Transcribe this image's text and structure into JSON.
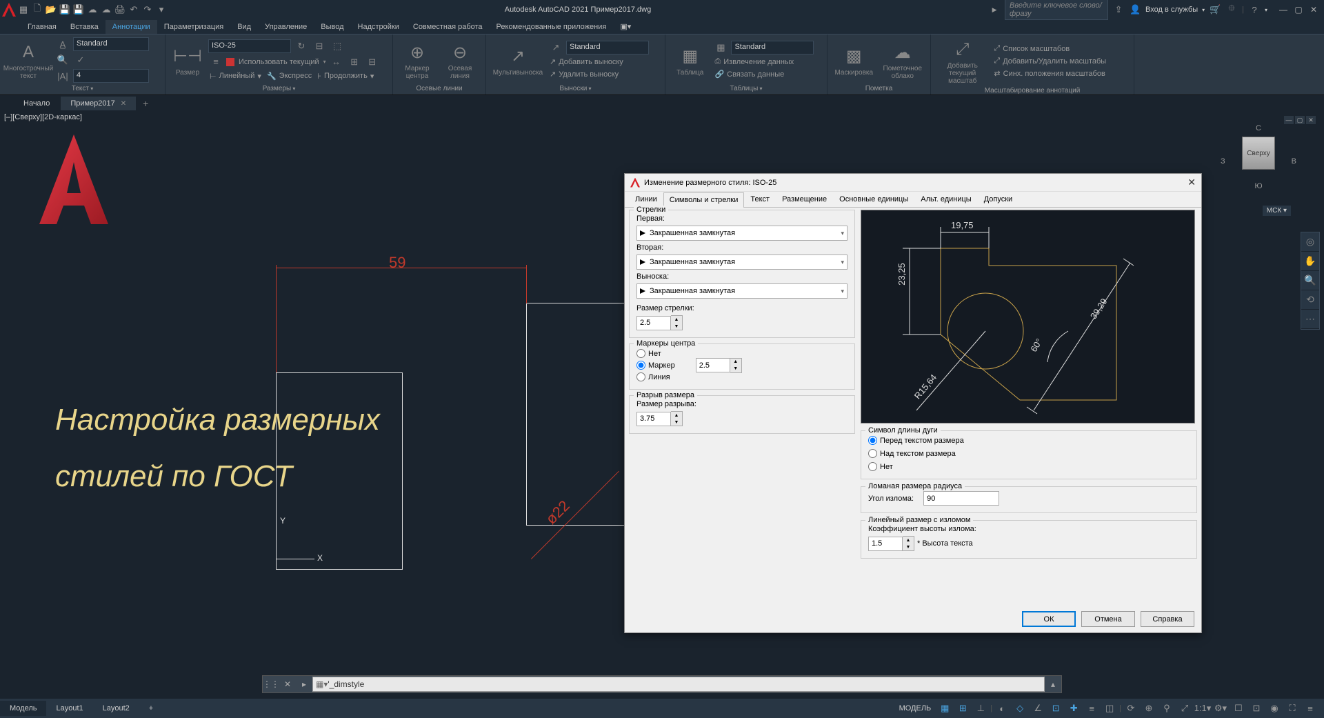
{
  "app": {
    "title": "Autodesk AutoCAD 2021   Пример2017.dwg"
  },
  "titlebar": {
    "search_placeholder": "Введите ключевое слово/фразу",
    "signin": "Вход в службы"
  },
  "ribbon_tabs": [
    "Главная",
    "Вставка",
    "Аннотации",
    "Параметризация",
    "Вид",
    "Управление",
    "Вывод",
    "Надстройки",
    "Совместная работа",
    "Рекомендованные приложения"
  ],
  "ribbon_active_tab": "Аннотации",
  "ribbon": {
    "text_panel": {
      "big": "Многострочный текст",
      "style": "Standard",
      "height": "4",
      "title": "Текст"
    },
    "dim_panel": {
      "big": "Размер",
      "style": "ISO-25",
      "use_current": "Использовать текущий",
      "linear": "Линейный",
      "express": "Экспресс",
      "continue": "Продолжить",
      "title": "Размеры"
    },
    "center_panel": {
      "marker": "Маркер центра",
      "axis": "Осевая линия",
      "title": "Осевые линии"
    },
    "leader_panel": {
      "multi": "Мультивыноска",
      "style": "Standard",
      "add": "Добавить выноску",
      "del": "Удалить выноску",
      "title": "Выноски"
    },
    "table_panel": {
      "big": "Таблица",
      "style": "Standard",
      "extract": "Извлечение данных",
      "link": "Связать данные",
      "title": "Таблицы"
    },
    "mark_panel": {
      "mask": "Маскировка",
      "cloud": "Пометочное облако",
      "title": "Пометка"
    },
    "scale_panel": {
      "add_del": "Добавить текущий масштаб",
      "list": "Список масштабов",
      "addrem": "Добавить/Удалить масштабы",
      "sync": "Синх. положения масштабов",
      "title": "Масштабирование аннотаций"
    }
  },
  "filetabs": {
    "start": "Начало",
    "file": "Пример2017"
  },
  "viewport_label": "[–][Сверху][2D-каркас]",
  "drawing": {
    "dim_h": "59",
    "dim_diag": "ø22",
    "x": "X",
    "y": "Y"
  },
  "overlay": {
    "line1": "Настройка размерных",
    "line2": "стилей по ГОСТ"
  },
  "viewcube": {
    "n": "С",
    "s": "Ю",
    "e": "В",
    "w": "З",
    "top": "Сверху",
    "wcs": "МСК"
  },
  "dialog": {
    "title": "Изменение размерного стиля: ISO-25",
    "tabs": [
      "Линии",
      "Символы и стрелки",
      "Текст",
      "Размещение",
      "Основные единицы",
      "Альт. единицы",
      "Допуски"
    ],
    "active_tab": "Символы и стрелки",
    "arrows": {
      "group": "Стрелки",
      "first_lbl": "Первая:",
      "first_val": "Закрашенная замкнутая",
      "second_lbl": "Вторая:",
      "second_val": "Закрашенная замкнутая",
      "leader_lbl": "Выноска:",
      "leader_val": "Закрашенная замкнутая",
      "size_lbl": "Размер стрелки:",
      "size_val": "2.5"
    },
    "center_marks": {
      "group": "Маркеры центра",
      "none": "Нет",
      "mark": "Маркер",
      "line": "Линия",
      "size": "2.5"
    },
    "dim_break": {
      "group": "Разрыв размера",
      "lbl": "Размер разрыва:",
      "val": "3.75"
    },
    "arc": {
      "group": "Символ длины дуги",
      "before": "Перед текстом размера",
      "above": "Над текстом размера",
      "none": "Нет"
    },
    "radius_jog": {
      "group": "Ломаная размера радиуса",
      "lbl": "Угол излома:",
      "val": "90"
    },
    "linear_jog": {
      "group": "Линейный размер с изломом",
      "lbl": "Коэффициент высоты излома:",
      "val": "1.5",
      "suffix": "* Высота текста"
    },
    "preview": {
      "d1": "19,75",
      "d2": "23,25",
      "d3": "39,29",
      "d4": "60°",
      "d5": "R15,64"
    },
    "btns": {
      "ok": "ОК",
      "cancel": "Отмена",
      "help": "Справка"
    }
  },
  "cmdline": {
    "text": "'_dimstyle"
  },
  "status": {
    "tabs": [
      "Модель",
      "Layout1",
      "Layout2"
    ],
    "model": "МОДЕЛЬ"
  }
}
